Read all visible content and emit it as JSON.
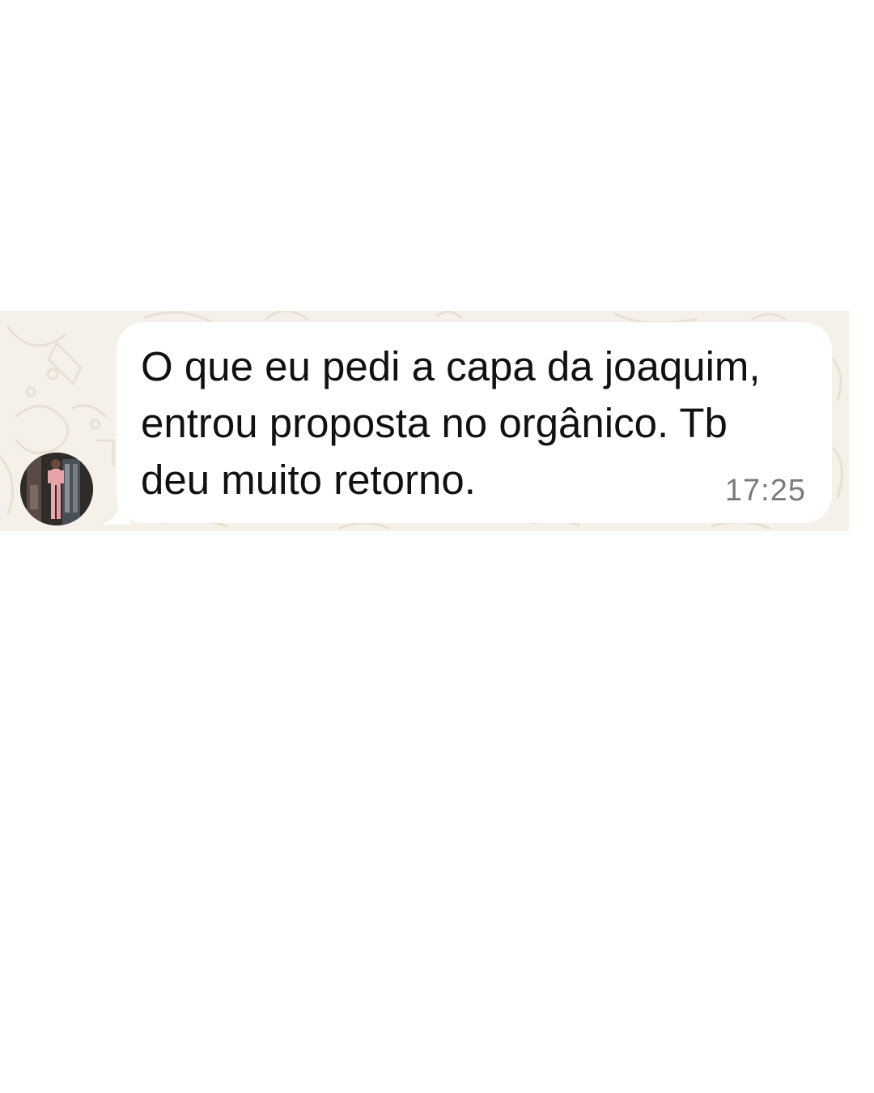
{
  "conversation": {
    "message": {
      "text": "O que eu pedi a capa da joaquim,\nentrou proposta no orgânico. Tb\ndeu muito retorno.",
      "time": "17:25",
      "direction": "incoming"
    },
    "sender": {
      "avatar_icon": "profile-photo"
    }
  },
  "colors": {
    "wallpaper": "#f5f1ea",
    "bubble": "#ffffff",
    "text": "#111111",
    "timestamp": "#7b7b7b"
  }
}
